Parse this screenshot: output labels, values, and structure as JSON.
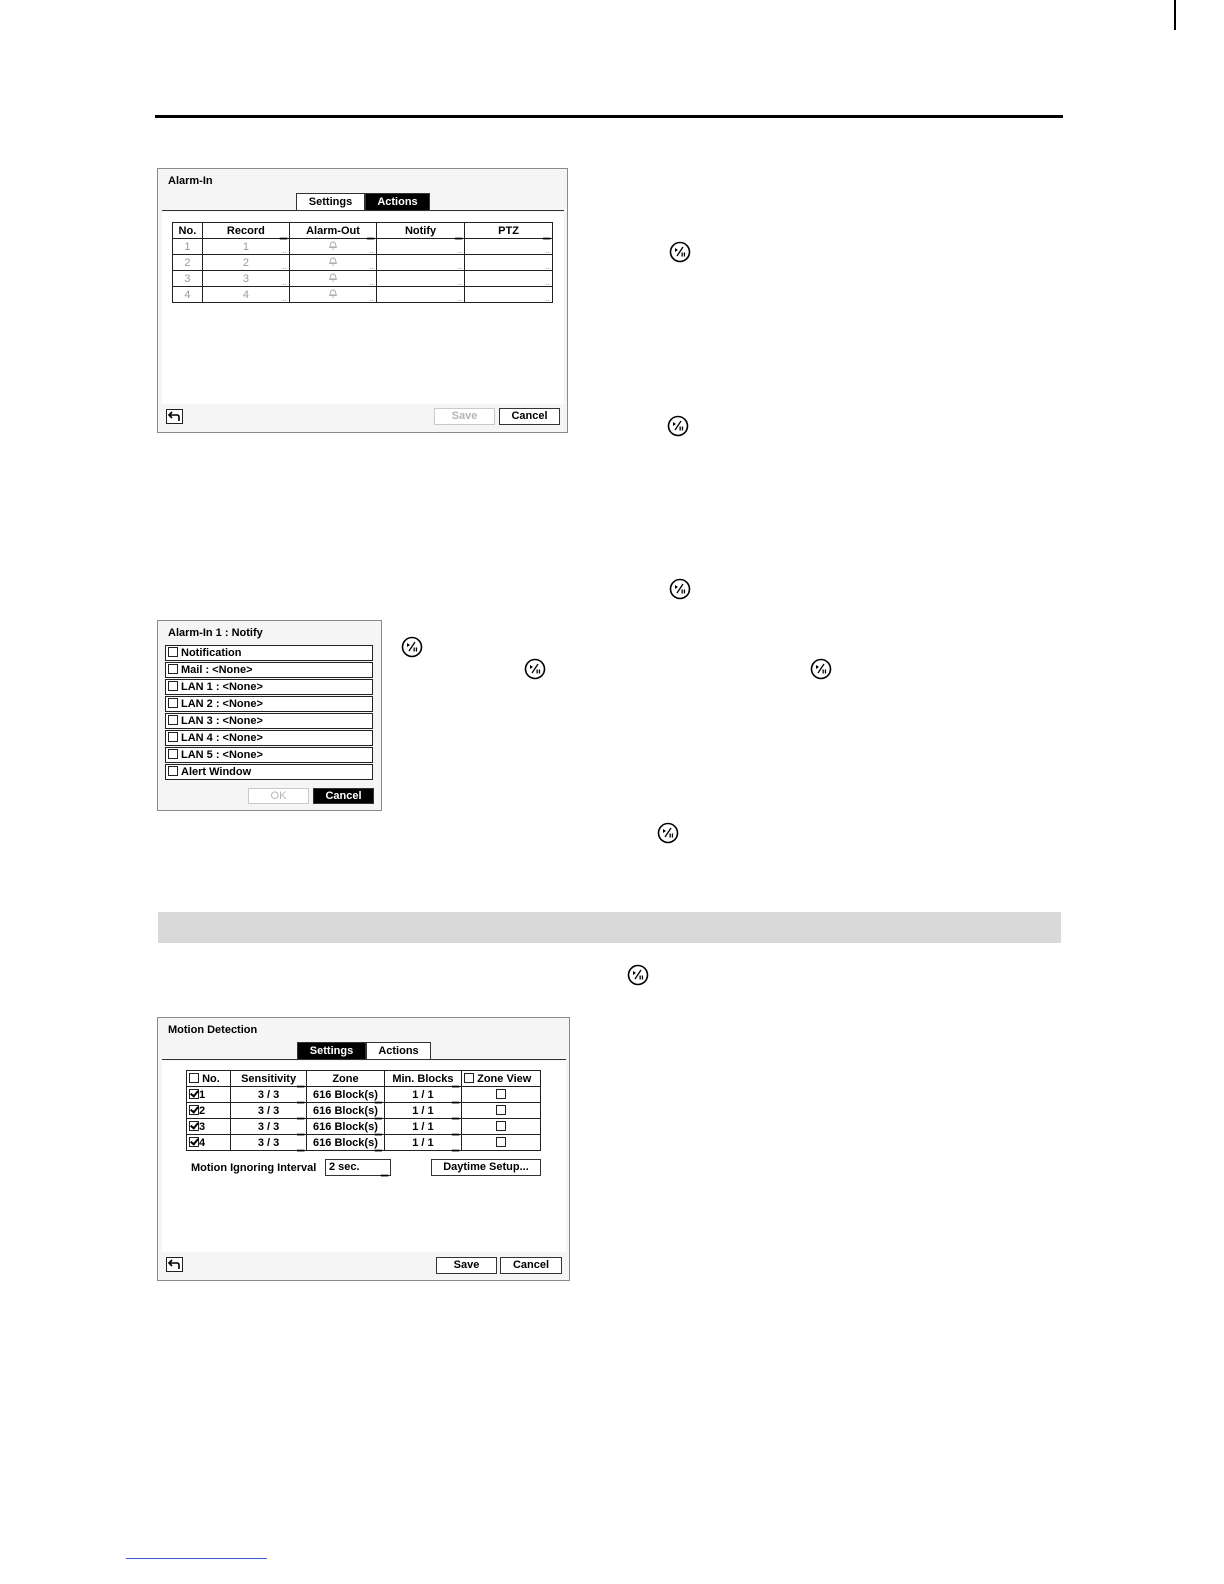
{
  "alarm_in": {
    "title": "Alarm-In",
    "tabs": [
      "Settings",
      "Actions"
    ],
    "active_tab": "Actions",
    "columns": [
      "No.",
      "Record",
      "Alarm-Out",
      "Notify",
      "PTZ"
    ],
    "rows": [
      {
        "no": "1",
        "record": "1"
      },
      {
        "no": "2",
        "record": "2"
      },
      {
        "no": "3",
        "record": "3"
      },
      {
        "no": "4",
        "record": "4"
      }
    ],
    "save_label": "Save",
    "cancel_label": "Cancel"
  },
  "notify_dialog": {
    "title": "Alarm-In 1 : Notify",
    "items": [
      {
        "label": "Notification",
        "checked": false
      },
      {
        "label": "Mail : <None>",
        "checked": false
      },
      {
        "label": "LAN 1 : <None>",
        "checked": false
      },
      {
        "label": "LAN 2 : <None>",
        "checked": false
      },
      {
        "label": "LAN 3 : <None>",
        "checked": false
      },
      {
        "label": "LAN 4 : <None>",
        "checked": false
      },
      {
        "label": "LAN 5 : <None>",
        "checked": false
      },
      {
        "label": "Alert Window",
        "checked": false
      }
    ],
    "ok_label": "OK",
    "cancel_label": "Cancel"
  },
  "motion": {
    "title": "Motion Detection",
    "tabs": [
      "Settings",
      "Actions"
    ],
    "active_tab": "Settings",
    "columns": [
      "No.",
      "Sensitivity",
      "Zone",
      "Min. Blocks",
      "Zone View"
    ],
    "rows": [
      {
        "no": "1",
        "checked": true,
        "sensitivity": "3 / 3",
        "zone": "616 Block(s)",
        "min_blocks": "1 / 1",
        "zone_view": false
      },
      {
        "no": "2",
        "checked": true,
        "sensitivity": "3 / 3",
        "zone": "616 Block(s)",
        "min_blocks": "1 / 1",
        "zone_view": false
      },
      {
        "no": "3",
        "checked": true,
        "sensitivity": "3 / 3",
        "zone": "616 Block(s)",
        "min_blocks": "1 / 1",
        "zone_view": false
      },
      {
        "no": "4",
        "checked": true,
        "sensitivity": "3 / 3",
        "zone": "616 Block(s)",
        "min_blocks": "1 / 1",
        "zone_view": false
      }
    ],
    "ignoring_interval_label": "Motion Ignoring Interval",
    "ignoring_interval_value": "2 sec.",
    "daytime_setup_label": "Daytime Setup...",
    "save_label": "Save",
    "cancel_label": "Cancel"
  },
  "icons": {
    "dvr_button": "play-pause-button-icon",
    "back": "return-arrow-icon",
    "bell": "bell-icon"
  }
}
